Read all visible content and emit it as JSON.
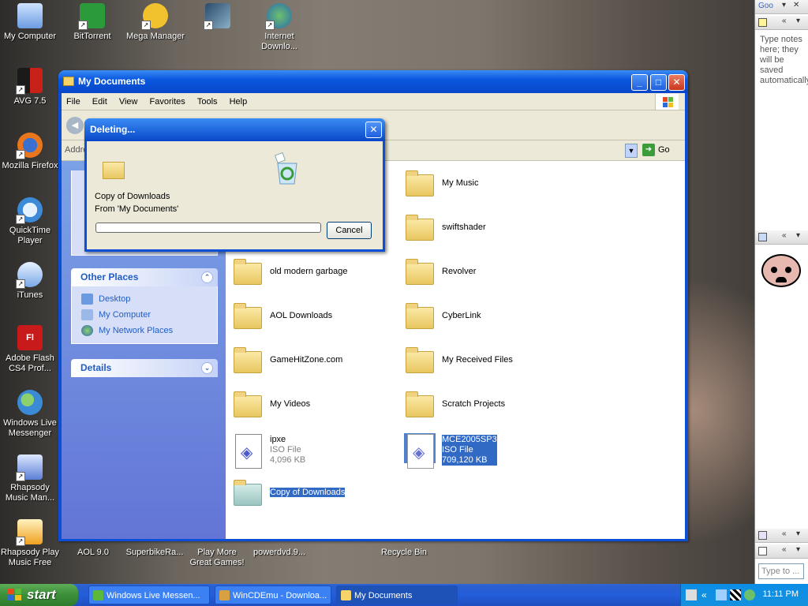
{
  "desktop": {
    "icons": [
      {
        "label": "My Computer"
      },
      {
        "label": "BitTorrent"
      },
      {
        "label": "Mega Manager"
      },
      {
        "label": "Internet Downlo..."
      },
      {
        "label": "AVG 7.5"
      },
      {
        "label": "Mozilla Firefox"
      },
      {
        "label": "QuickTime Player"
      },
      {
        "label": "iTunes"
      },
      {
        "label": "Adobe Flash CS4 Prof..."
      },
      {
        "label": "Windows Live Messenger"
      },
      {
        "label": "Rhapsody Music Man..."
      },
      {
        "label": "Rhapsody Play Music Free"
      },
      {
        "label": "AOL 9.0"
      },
      {
        "label": "SuperbikeRa..."
      },
      {
        "label": "Play More Great Games!"
      },
      {
        "label": "powerdvd.9..."
      },
      {
        "label": "Recycle Bin"
      }
    ]
  },
  "window": {
    "title": "My Documents",
    "menu": [
      "File",
      "Edit",
      "View",
      "Favorites",
      "Tools",
      "Help"
    ],
    "address_label": "Addre",
    "go_label": "Go",
    "other_places": {
      "title": "Other Places",
      "links": [
        "Desktop",
        "My Computer",
        "My Network Places"
      ]
    },
    "details": {
      "title": "Details"
    },
    "files": [
      {
        "name": "My Music"
      },
      {
        "name": "swiftshader"
      },
      {
        "name": "old modern garbage"
      },
      {
        "name": "Revolver"
      },
      {
        "name": "AOL Downloads"
      },
      {
        "name": "CyberLink"
      },
      {
        "name": "GameHitZone.com"
      },
      {
        "name": "My Received Files"
      },
      {
        "name": "My Videos"
      },
      {
        "name": "Scratch Projects"
      },
      {
        "name": "ipxe",
        "type": "ISO File",
        "size": "4,096 KB"
      },
      {
        "name": "MCE2005SP3",
        "type": "ISO File",
        "size": "709,120 KB"
      },
      {
        "name": "Copy of Downloads"
      }
    ]
  },
  "dialog": {
    "title": "Deleting...",
    "line1": "Copy of Downloads",
    "line2": "From 'My Documents'",
    "cancel": "Cancel",
    "progress": 0
  },
  "sidebar": {
    "notes_title": "Goo",
    "notes_text": "Type notes here; they will be saved automatically.",
    "search_placeholder": "Type to ..."
  },
  "taskbar": {
    "start_label": "start",
    "tasks": [
      {
        "label": "Windows Live Messen..."
      },
      {
        "label": "WinCDEmu - Downloa..."
      },
      {
        "label": "My Documents"
      }
    ],
    "clock": "11:11 PM"
  },
  "colors": {
    "xp_blue": "#0a4fd6",
    "selection": "#316ac5",
    "taskbar": "#245edb",
    "start_green": "#3c8f3a"
  }
}
